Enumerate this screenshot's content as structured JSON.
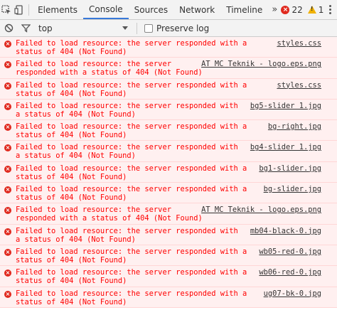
{
  "tabs": {
    "items": [
      "Elements",
      "Console",
      "Sources",
      "Network",
      "Timeline"
    ],
    "active": "Console",
    "more": "»"
  },
  "counts": {
    "errors": "22",
    "warnings": "1"
  },
  "toolbar": {
    "context": "top",
    "preserve_label": "Preserve log"
  },
  "messages": [
    {
      "text": "Failed to load resource: the server responded with a status of 404 (Not Found)",
      "source": "styles.css"
    },
    {
      "text": "Failed to load resource: the server responded with a status of 404 (Not Found)",
      "source": "AT MC Teknik - logo.eps.png"
    },
    {
      "text": "Failed to load resource: the server responded with a status of 404 (Not Found)",
      "source": "styles.css"
    },
    {
      "text": "Failed to load resource: the server responded with a status of 404 (Not Found)",
      "source": "bg5-slider 1.jpg"
    },
    {
      "text": "Failed to load resource: the server responded with a status of 404 (Not Found)",
      "source": "bg-right.jpg"
    },
    {
      "text": "Failed to load resource: the server responded with a status of 404 (Not Found)",
      "source": "bg4-slider 1.jpg"
    },
    {
      "text": "Failed to load resource: the server responded with a status of 404 (Not Found)",
      "source": "bg1-slider.jpg"
    },
    {
      "text": "Failed to load resource: the server responded with a status of 404 (Not Found)",
      "source": "bg-slider.jpg"
    },
    {
      "text": "Failed to load resource: the server responded with a status of 404 (Not Found)",
      "source": "AT MC Teknik - logo.eps.png"
    },
    {
      "text": "Failed to load resource: the server responded with a status of 404 (Not Found)",
      "source": "mb04-black-0.jpg"
    },
    {
      "text": "Failed to load resource: the server responded with a status of 404 (Not Found)",
      "source": "wb05-red-0.jpg"
    },
    {
      "text": "Failed to load resource: the server responded with a status of 404 (Not Found)",
      "source": "wb06-red-0.jpg"
    },
    {
      "text": "Failed to load resource: the server responded with a status of 404 (Not Found)",
      "source": "ug07-bk-0.jpg"
    }
  ]
}
